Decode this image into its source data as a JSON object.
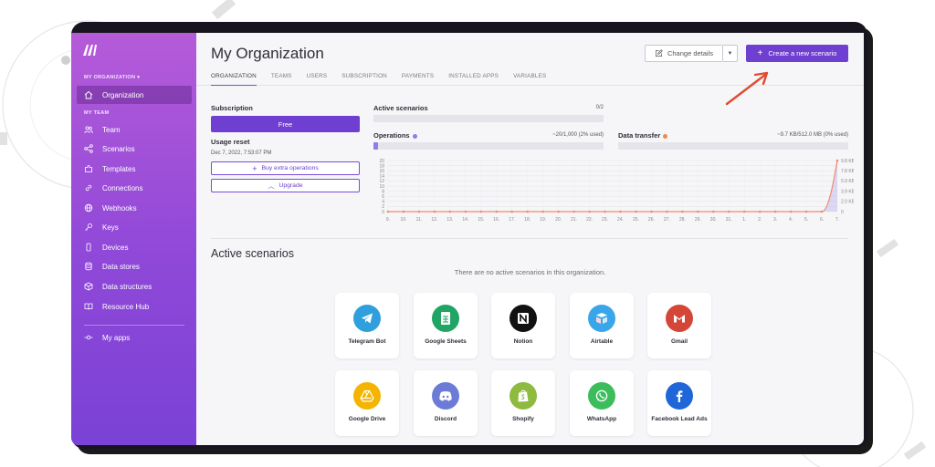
{
  "sidebar": {
    "org_label": "MY ORGANIZATION ▾",
    "team_label": "MY TEAM",
    "items": [
      {
        "label": "Organization",
        "icon": "home-icon"
      },
      {
        "label": "Team",
        "icon": "users-icon"
      },
      {
        "label": "Scenarios",
        "icon": "share-icon"
      },
      {
        "label": "Templates",
        "icon": "puzzle-icon"
      },
      {
        "label": "Connections",
        "icon": "link-icon"
      },
      {
        "label": "Webhooks",
        "icon": "globe-icon"
      },
      {
        "label": "Keys",
        "icon": "key-icon"
      },
      {
        "label": "Devices",
        "icon": "phone-icon"
      },
      {
        "label": "Data stores",
        "icon": "database-icon"
      },
      {
        "label": "Data structures",
        "icon": "cube-icon"
      },
      {
        "label": "Resource Hub",
        "icon": "book-icon"
      },
      {
        "label": "My apps",
        "icon": "apps-icon"
      }
    ]
  },
  "header": {
    "title": "My Organization",
    "change_details": "Change details",
    "create_scenario": "Create a new scenario",
    "tabs": [
      "ORGANIZATION",
      "TEAMS",
      "USERS",
      "SUBSCRIPTION",
      "PAYMENTS",
      "INSTALLED APPS",
      "VARIABLES"
    ]
  },
  "subscription": {
    "label": "Subscription",
    "plan": "Free",
    "usage_reset_label": "Usage reset",
    "usage_reset_date": "Dec 7, 2022, 7:53:07 PM",
    "buy_extra": "Buy extra operations",
    "upgrade": "Upgrade"
  },
  "stats": {
    "active_label": "Active scenarios",
    "active_value": "0/2",
    "active_fraction": 0,
    "operations_label": "Operations",
    "operations_value": "~20/1,000 (2% used)",
    "operations_fraction": 0.02,
    "transfer_label": "Data transfer",
    "transfer_value": "~9.7 KB/512.0 MB (0% used)",
    "transfer_fraction": 0,
    "ops_color": "#8b7ee6",
    "transfer_color": "#f08a4b"
  },
  "chart_data": {
    "type": "line",
    "categories": [
      "9.",
      "10.",
      "11.",
      "12.",
      "13.",
      "14.",
      "15.",
      "16.",
      "17.",
      "18.",
      "19.",
      "20.",
      "21.",
      "22.",
      "23.",
      "24.",
      "25.",
      "26.",
      "27.",
      "28.",
      "29.",
      "30.",
      "31.",
      "1.",
      "2.",
      "3.",
      "4.",
      "5.",
      "6.",
      "7."
    ],
    "series": [
      {
        "values": [
          0,
          0,
          0,
          0,
          0,
          0,
          0,
          0,
          0,
          0,
          0,
          0,
          0,
          0,
          0,
          0,
          0,
          0,
          0,
          0,
          0,
          0,
          0,
          0,
          0,
          0,
          0,
          0,
          0,
          20
        ]
      },
      {
        "values": [
          0,
          0,
          0,
          0,
          0,
          0,
          0,
          0,
          0,
          0,
          0,
          0,
          0,
          0,
          0,
          0,
          0,
          0,
          0,
          0,
          0,
          0,
          0,
          0,
          0,
          0,
          0,
          0,
          0,
          9.8
        ]
      }
    ],
    "left_ticks": [
      "20",
      "18",
      "16",
      "14",
      "12",
      "10",
      "8",
      "6",
      "4",
      "2",
      "0"
    ],
    "right_ticks": [
      "9.8 KB",
      "7.8 KB",
      "5.9 KB",
      "3.9 KB",
      "2.0 KB",
      "0"
    ],
    "ylim_left": [
      0,
      20
    ],
    "ylim_right": [
      0,
      9.8
    ],
    "grid": true
  },
  "active": {
    "title": "Active scenarios",
    "empty": "There are no active scenarios in this organization."
  },
  "apps": [
    {
      "label": "Telegram Bot",
      "icon": "telegram-icon",
      "color": "#2f9fde"
    },
    {
      "label": "Google Sheets",
      "icon": "google-sheets-icon",
      "color": "#21a464"
    },
    {
      "label": "Notion",
      "icon": "notion-icon",
      "color": "#111111"
    },
    {
      "label": "Airtable",
      "icon": "airtable-icon",
      "color": "#3aa6ea"
    },
    {
      "label": "Gmail",
      "icon": "gmail-icon",
      "color": "#d44638"
    },
    {
      "label": "Google Drive",
      "icon": "google-drive-icon",
      "color": "#f4b400"
    },
    {
      "label": "Discord",
      "icon": "discord-icon",
      "color": "#6b7bd6"
    },
    {
      "label": "Shopify",
      "icon": "shopify-icon",
      "color": "#8dba3f"
    },
    {
      "label": "WhatsApp",
      "icon": "whatsapp-icon",
      "color": "#3cbd5c"
    },
    {
      "label": "Facebook Lead Ads",
      "icon": "facebook-icon",
      "color": "#1f66d8"
    }
  ]
}
